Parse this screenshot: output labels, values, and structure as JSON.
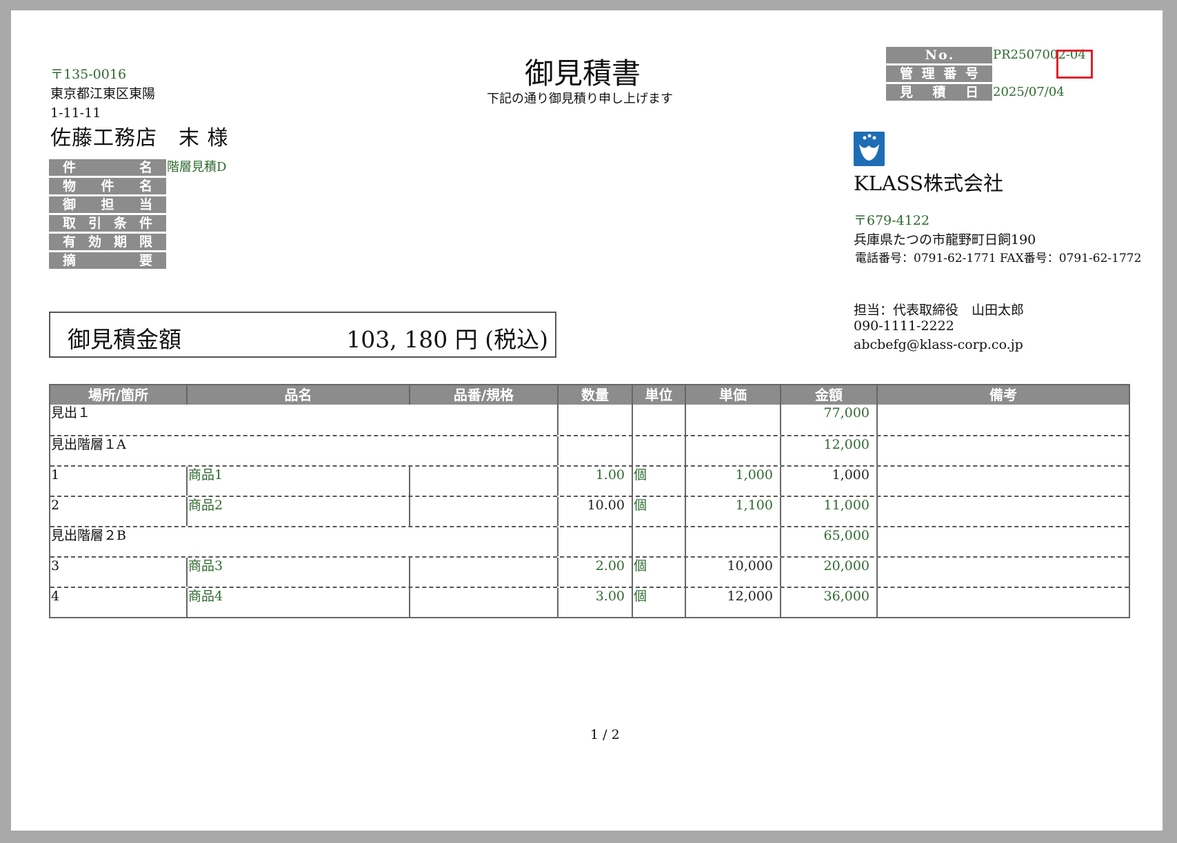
{
  "customer": {
    "postal": "〒135-0016",
    "address1": "東京都江東区東陽",
    "address2": "1-11-11",
    "name": "佐藤工務店　末 様"
  },
  "title": "御見積書",
  "subtitle": "下記の通り御見積り申し上げます",
  "meta": {
    "no_label": [
      "N",
      "o",
      "."
    ],
    "no_value": "PR2507002-04",
    "mgmt_label": [
      "管",
      "理",
      "番",
      "号"
    ],
    "mgmt_value": "",
    "date_label": [
      "見",
      "積",
      "日"
    ],
    "date_value": "2025/07/04"
  },
  "fields": [
    {
      "label": [
        "件",
        "名"
      ],
      "value": "階層見積D"
    },
    {
      "label": [
        "物",
        "件",
        "名"
      ],
      "value": ""
    },
    {
      "label": [
        "御",
        "担",
        "当"
      ],
      "value": ""
    },
    {
      "label": [
        "取",
        "引",
        "条",
        "件"
      ],
      "value": ""
    },
    {
      "label": [
        "有",
        "効",
        "期",
        "限"
      ],
      "value": ""
    },
    {
      "label": [
        "摘",
        "要"
      ],
      "value": ""
    }
  ],
  "total": {
    "label": "御見積金額",
    "amount": "103, 180 円 (税込)"
  },
  "company": {
    "name": "KLASS株式会社",
    "postal": "〒679-4122",
    "address": "兵庫県たつの市龍野町日飼190",
    "phone": "電話番号：0791-62-1771 FAX番号：0791-62-1772",
    "contact": "担当：代表取締役　山田太郎",
    "mobile": "090-1111-2222",
    "email": "abcbefg@klass-corp.co.jp"
  },
  "table": {
    "headers": [
      "場所/箇所",
      "品名",
      "品番/規格",
      "数量",
      "単位",
      "単価",
      "金額",
      "備考"
    ],
    "rows": [
      {
        "type": "heading",
        "name": "見出１",
        "amount": "77,000"
      },
      {
        "type": "heading",
        "name": "見出階層１A",
        "amount": "12,000"
      },
      {
        "type": "item",
        "place": "1",
        "item": "商品1",
        "spec": "",
        "qty": "1.00",
        "unit": "個",
        "price": "1,000",
        "amount": "1,000",
        "note": ""
      },
      {
        "type": "item",
        "place": "2",
        "item": "商品2",
        "spec": "",
        "qty": "10.00",
        "unit": "個",
        "price": "1,100",
        "amount": "11,000",
        "note": ""
      },
      {
        "type": "heading",
        "name": "見出階層２B",
        "amount": "65,000"
      },
      {
        "type": "item",
        "place": "3",
        "item": "商品3",
        "spec": "",
        "qty": "2.00",
        "unit": "個",
        "price": "10,000",
        "amount": "20,000",
        "note": ""
      },
      {
        "type": "item",
        "place": "4",
        "item": "商品4",
        "spec": "",
        "qty": "3.00",
        "unit": "個",
        "price": "12,000",
        "amount": "36,000",
        "note": ""
      }
    ]
  },
  "page_number": "1 / 2",
  "colors": {
    "label_bg": "#8c8c8c",
    "value_text": "#2e6a2e",
    "highlight": "#e0202a",
    "logo": "#1e6db5"
  }
}
